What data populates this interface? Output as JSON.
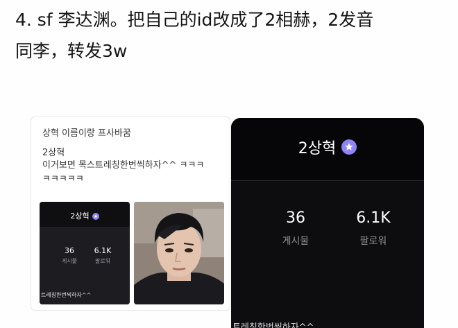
{
  "headline": {
    "line1": "4. sf 李达渊。把自己的id改成了2相赫，2发音",
    "line2": "同李，转发3w"
  },
  "post": {
    "caption": "상혁 이름이랑 프사바꿈",
    "author": "2상혁",
    "text_line1": "이거보면 목스트레칭한번씩하자^^ ㅋㅋㅋ",
    "text_line2": "ㅋㅋㅋㅋㅋ"
  },
  "profile": {
    "name": "2상혁",
    "posts_count": "36",
    "posts_label": "게시물",
    "followers_count": "6.1K",
    "followers_label": "팔로워",
    "bottom_text": "트레칭한번씩하자^^"
  },
  "colors": {
    "badge": "#8e84f5",
    "profile_bg": "#0d0d10"
  }
}
